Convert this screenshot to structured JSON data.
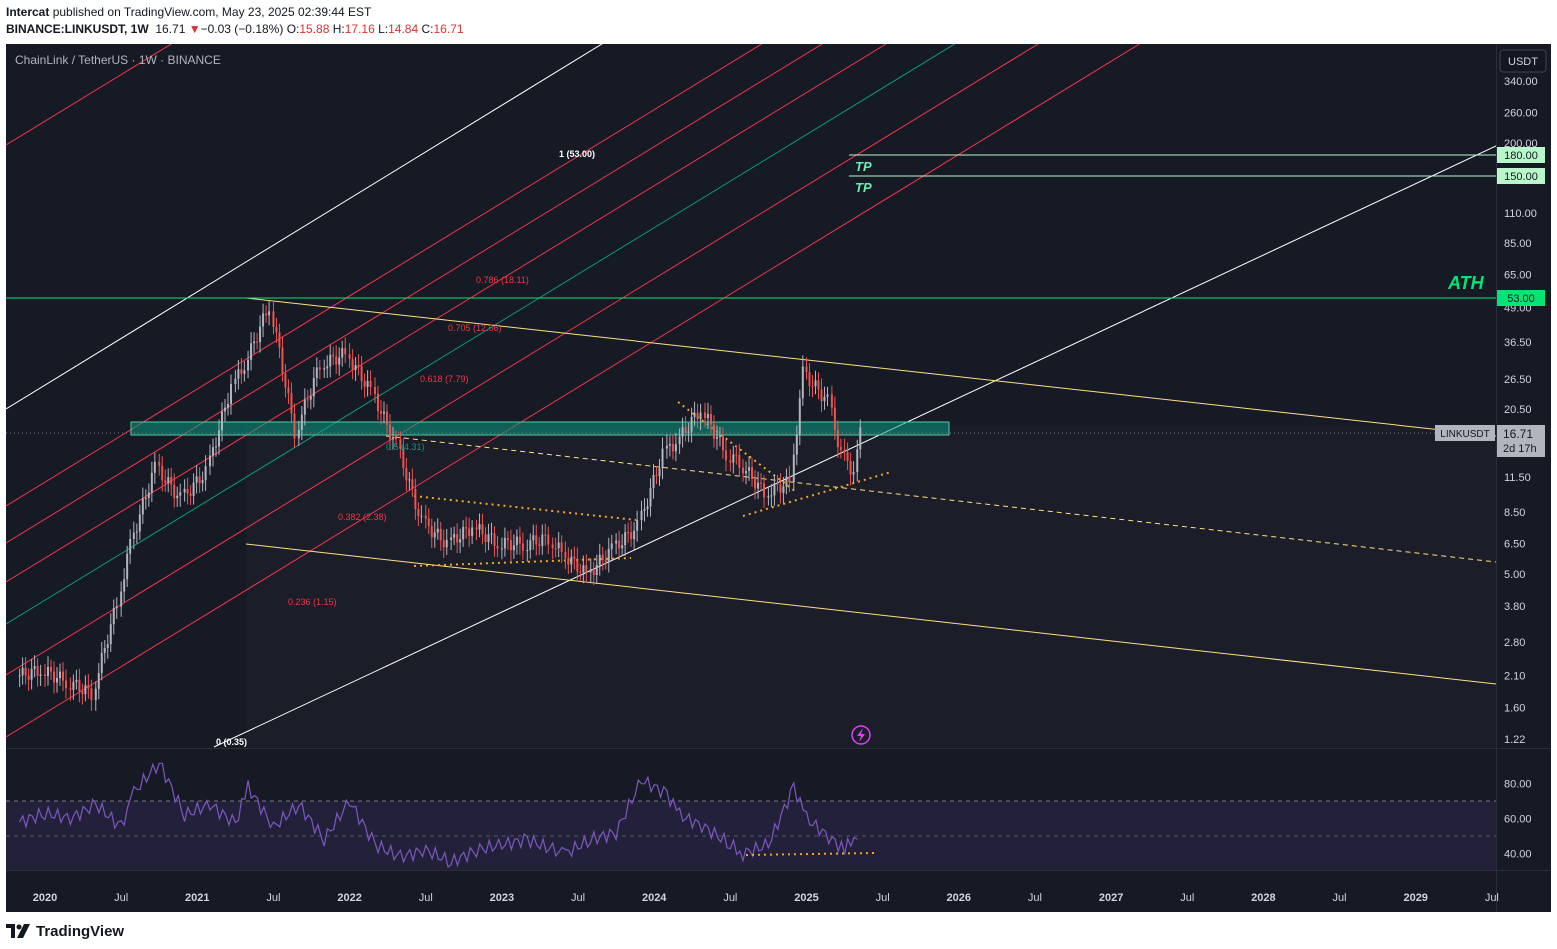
{
  "header": {
    "author": "Intercat",
    "published_text": "published on TradingView.com, May 23, 2025 02:39:44 EST",
    "symbol": "BINANCE:LINKUSDT, 1W",
    "last": "16.71",
    "arrow": "▼",
    "change": "−0.03 (−0.18%)",
    "o_label": "O:",
    "o": "15.88",
    "h_label": "H:",
    "h": "17.16",
    "l_label": "L:",
    "l": "14.84",
    "c_label": "C:",
    "c": "16.71"
  },
  "chart": {
    "legend": "ChainLink / TetherUS · 1W · BINANCE",
    "currency_button": "USDT",
    "price_label_symbol": "LINKUSDT",
    "price_label_value": "16.71",
    "price_label_countdown": "2d 17h",
    "ath_text": "ATH",
    "tp_text": "TP",
    "colors": {
      "background": "#161a25",
      "candle_up": "#b2b5be",
      "candle_down": "#ef5350",
      "fib_line": "#f23645",
      "fib_mid": "#089981",
      "channel": "#ffe082",
      "rsi": "#7e57c2",
      "tp_line": "#b9f6ca",
      "ath_line": "#00e676"
    }
  },
  "chart_data": {
    "type": "line",
    "title": "ChainLink / TetherUS · 1W · BINANCE",
    "xlabel": "",
    "ylabel": "",
    "y_scale": "log",
    "y_ticks": [
      "340.00",
      "260.00",
      "200.00",
      "110.00",
      "85.00",
      "65.00",
      "49.00",
      "36.50",
      "26.50",
      "20.50",
      "11.50",
      "8.50",
      "6.50",
      "5.00",
      "3.80",
      "2.80",
      "2.10",
      "1.60",
      "1.22"
    ],
    "x_ticks": [
      "2020",
      "Jul",
      "2021",
      "Jul",
      "2022",
      "Jul",
      "2023",
      "Jul",
      "2024",
      "Jul",
      "2025",
      "Jul",
      "2026",
      "Jul",
      "2027",
      "Jul",
      "2028",
      "Jul",
      "2029",
      "Jul"
    ],
    "x": [
      "2019-11",
      "2020-01",
      "2020-03",
      "2020-05",
      "2020-07",
      "2020-08",
      "2020-10",
      "2020-12",
      "2021-02",
      "2021-04",
      "2021-05",
      "2021-07",
      "2021-09",
      "2021-11",
      "2022-01",
      "2022-03",
      "2022-05",
      "2022-07",
      "2022-09",
      "2022-11",
      "2023-01",
      "2023-03",
      "2023-05",
      "2023-06",
      "2023-08",
      "2023-10",
      "2023-12",
      "2024-02",
      "2024-03",
      "2024-05",
      "2024-07",
      "2024-08",
      "2024-10",
      "2024-12",
      "2025-01",
      "2025-03",
      "2025-04",
      "2025-05"
    ],
    "series": [
      {
        "values": [
          2.2,
          2.0,
          1.8,
          3.9,
          6.5,
          12.5,
          9.5,
          12.0,
          25.0,
          30.0,
          50.0,
          17.0,
          30.0,
          33.0,
          24.0,
          15.0,
          7.8,
          6.5,
          7.5,
          6.5,
          6.5,
          6.8,
          6.0,
          5.0,
          6.2,
          7.5,
          14.0,
          15.5,
          20.5,
          14.0,
          13.0,
          10.0,
          11.0,
          28.0,
          22.0,
          14.0,
          12.0,
          16.71
        ]
      }
    ],
    "annotations": [
      "1 (53.00)",
      "0.786 (18.11)",
      "0.705 (12.66)",
      "0.618 (7.79)",
      "0.5 (4.31)",
      "0.382 (2.38)",
      "0.236 (1.15)",
      "0 (0.35)"
    ],
    "levels": [
      {
        "label": "TP",
        "value": "180.00"
      },
      {
        "label": "TP",
        "value": "150.00"
      },
      {
        "label": "ATH",
        "value": "53.00"
      }
    ],
    "rsi": {
      "y_ticks": [
        "80.00",
        "60.00",
        "40.00"
      ],
      "values": [
        58,
        63,
        60,
        68,
        55,
        75,
        92,
        62,
        68,
        57,
        78,
        55,
        68,
        48,
        70,
        45,
        38,
        42,
        35,
        42,
        45,
        48,
        42,
        40,
        48,
        52,
        82,
        74,
        62,
        55,
        45,
        40,
        45,
        78,
        60,
        48,
        42,
        52
      ]
    }
  }
}
